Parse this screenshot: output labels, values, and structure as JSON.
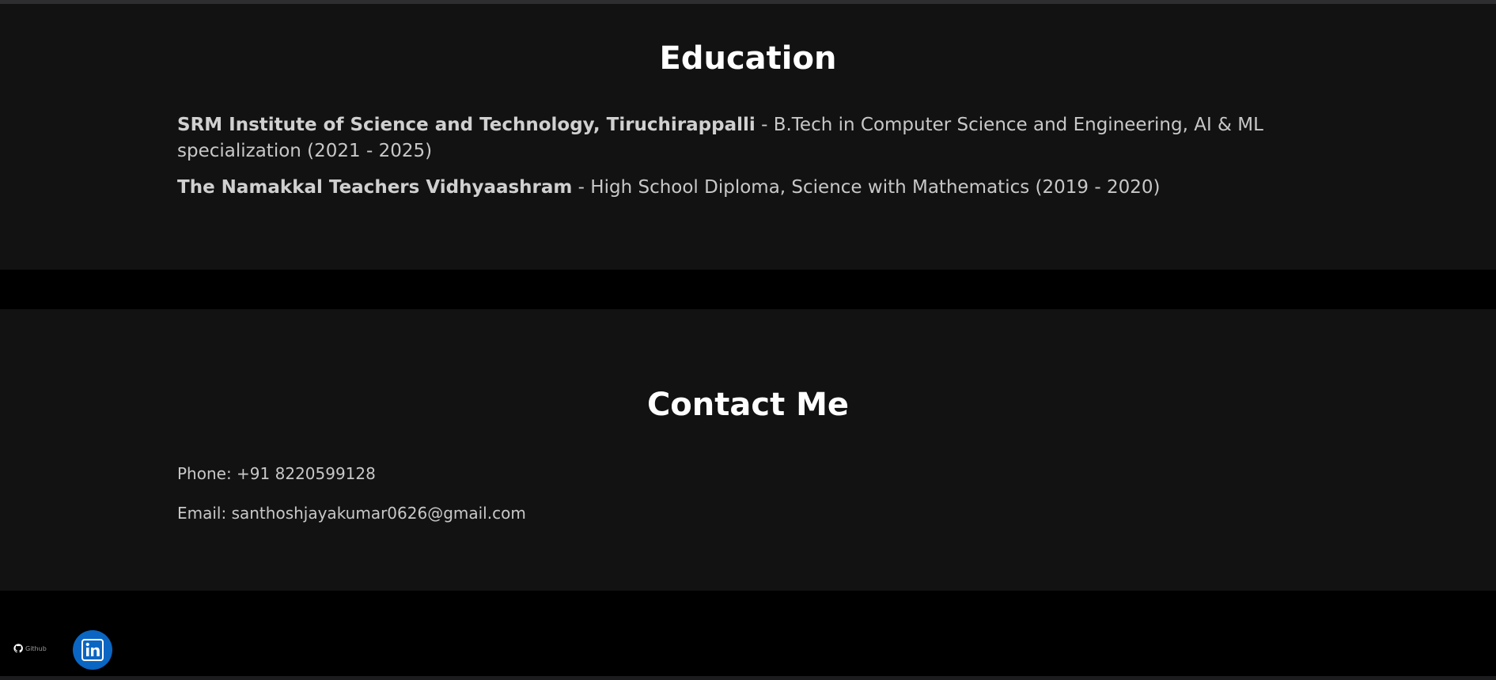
{
  "education": {
    "title": "Education",
    "items": [
      {
        "school": "SRM Institute of Science and Technology, Tiruchirappalli",
        "detail": " - B.Tech in Computer Science and Engineering, AI & ML specialization (2021 - 2025)"
      },
      {
        "school": "The Namakkal Teachers Vidhyaashram",
        "detail": " - High School Diploma, Science with Mathematics (2019 - 2020)"
      }
    ]
  },
  "contact": {
    "title": "Contact Me",
    "phone": "Phone: +91 8220599128",
    "email": "Email: santhoshjayakumar0626@gmail.com"
  },
  "footer": {
    "github_label": "Github",
    "github_icon": "github-icon",
    "linkedin_icon": "linkedin-icon"
  },
  "colors": {
    "background": "#000000",
    "section": "#121212",
    "heading": "#ffffff",
    "text": "#c8c8c8",
    "linkedin": "#0a66c2"
  }
}
